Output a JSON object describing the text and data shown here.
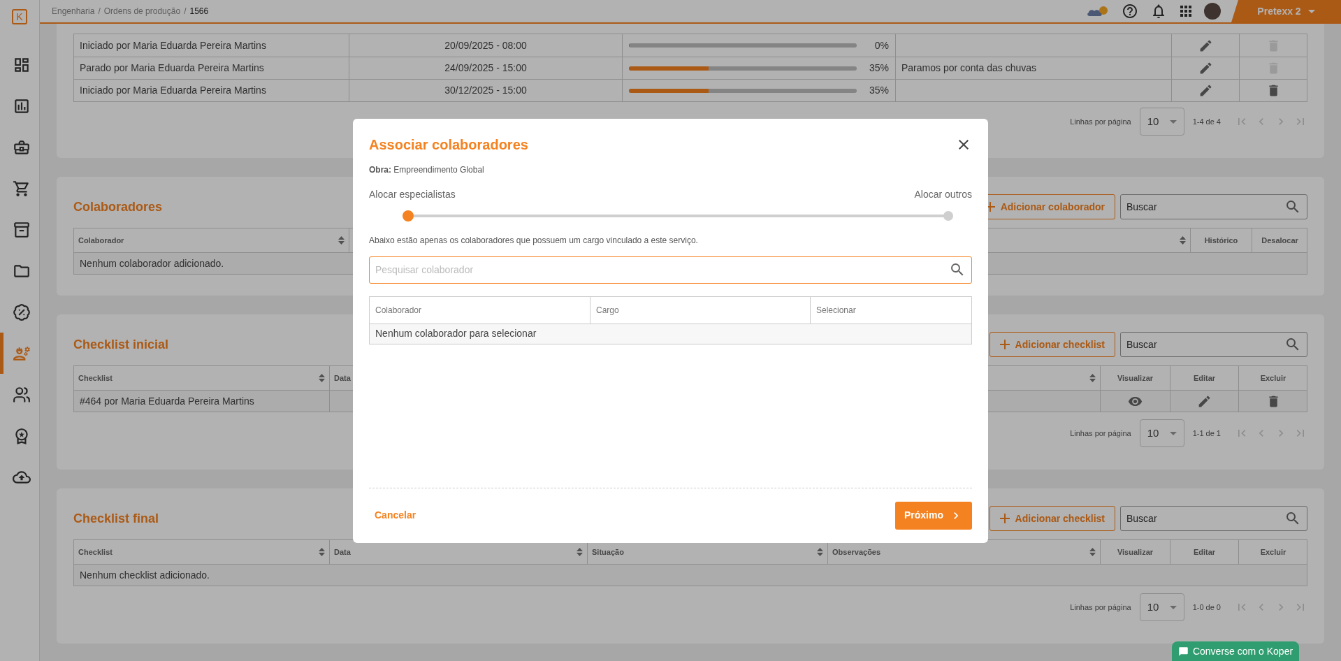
{
  "topbar": {
    "logo": "K",
    "breadcrumb": [
      {
        "label": "Engenharia",
        "current": false
      },
      {
        "label": "/",
        "current": false
      },
      {
        "label": "Ordens de produção",
        "current": false
      },
      {
        "label": "/",
        "current": false
      },
      {
        "label": "1566",
        "current": true
      }
    ],
    "company": "Pretexx 2"
  },
  "sidebar": {
    "items": [
      {
        "selected": false
      },
      {
        "selected": false
      },
      {
        "selected": false
      },
      {
        "selected": false
      },
      {
        "selected": false
      },
      {
        "selected": false
      },
      {
        "selected": false
      },
      {
        "selected": true
      },
      {
        "selected": false
      },
      {
        "selected": false
      },
      {
        "selected": false
      }
    ]
  },
  "stages": {
    "rows": [
      {
        "status": "Iniciado por Maria Eduarda Pereira Martins",
        "date": "20/09/2025 - 08:00",
        "level": 0,
        "percent": "0%",
        "notes": "",
        "delete_disabled": true
      },
      {
        "status": "Parado por Maria Eduarda Pereira Martins",
        "date": "24/09/2025 - 15:00",
        "level": 0.35,
        "percent": "35%",
        "notes": "Paramos por conta das chuvas",
        "delete_disabled": true
      },
      {
        "status": "Iniciado por Maria Eduarda Pereira Martins",
        "date": "30/12/2025 - 15:00",
        "level": 0.35,
        "percent": "35%",
        "notes": "",
        "delete_disabled": false
      }
    ],
    "pagination": {
      "label": "Linhas por página",
      "value": "10",
      "range": "1-4 de 4"
    }
  },
  "collaborators": {
    "title": "Colaboradores",
    "add_button": "Adicionar colaborador",
    "search_placeholder": "Buscar",
    "columns": [
      {
        "label": "Colaborador",
        "sortable": true
      },
      {
        "sortable": true
      },
      {
        "label": "Histórico",
        "sortable": false
      },
      {
        "label": "Desalocar",
        "sortable": false
      }
    ],
    "empty": "Nenhum colaborador adicionado."
  },
  "initial_checklist": {
    "title": "Checklist inicial",
    "add_button": "Adicionar checklist",
    "search_placeholder": "Buscar",
    "columns": [
      {
        "label": "Checklist",
        "sortable": true
      },
      {
        "label": "Data"
      },
      {
        "sortable": true
      },
      {
        "label": "Visualizar",
        "sortable": false
      },
      {
        "label": "Editar",
        "sortable": false
      },
      {
        "label": "Excluir",
        "sortable": false
      }
    ],
    "rows": [
      {
        "cells": [
          "#464 por Maria Eduarda Pereira Martins"
        ]
      }
    ],
    "pagination": {
      "label": "Linhas por página",
      "value": "10",
      "range": "1-1 de 1"
    }
  },
  "final_checklist": {
    "title": "Checklist final",
    "add_button": "Adicionar checklist",
    "search_placeholder": "Buscar",
    "columns": [
      {
        "label": "Checklist",
        "sortable": true
      },
      {
        "label": "Data",
        "sortable": true
      },
      {
        "label": "Situação",
        "sortable": true
      },
      {
        "label": "Observações",
        "sortable": true
      },
      {
        "label": "Visualizar",
        "sortable": false
      },
      {
        "label": "Editar",
        "sortable": false
      },
      {
        "label": "Excluir",
        "sortable": false
      }
    ],
    "empty": "Nenhum checklist adicionado.",
    "pagination": {
      "label": "Linhas por página",
      "value": "10",
      "range": "1-0 de 0"
    }
  },
  "modal": {
    "title": "Associar colaboradores",
    "project": "**Obra:** Empreendimento Global",
    "slider": {
      "left_label": "Alocar especialistas",
      "right_label": "Alocar outros",
      "level": 0
    },
    "hint": "Abaixo estão apenas os colaboradores que possuem um cargo vinculado a este serviço.",
    "search_placeholder": "Pesquisar colaborador",
    "columns": [
      "Colaborador",
      "Cargo",
      "Selecionar"
    ],
    "empty": "Nenhum colaborador para selecionar",
    "cancel": "Cancelar",
    "next": "Próximo"
  },
  "chat": {
    "label": "Converse com o Koper"
  }
}
